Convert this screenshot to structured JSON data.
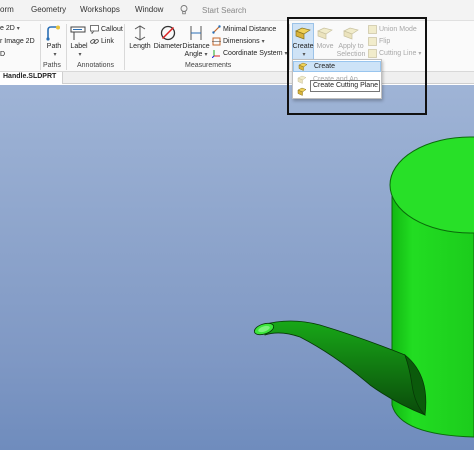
{
  "menubar": {
    "items": [
      "orm",
      "Geometry",
      "Workshops",
      "Window"
    ],
    "search_placeholder": "Start Search"
  },
  "ribbon": {
    "left_partial": [
      "e 2D",
      "r Image 2D",
      "D"
    ],
    "paths": {
      "button": "Path",
      "group": "Paths"
    },
    "annotations": {
      "label_button": "Label",
      "callout": "Callout",
      "link": "Link",
      "group": "Annotations"
    },
    "measurements": {
      "length": "Length",
      "diameter": "Diameter",
      "distance_angle_line1": "Distance",
      "distance_angle_line2": "Angle",
      "minimal_distance": "Minimal Distance",
      "dimensions": "Dimensions",
      "coordinate_system": "Coordinate System",
      "group": "Measurements"
    },
    "sections": {
      "create": "Create",
      "move": "Move",
      "apply_line1": "Apply to",
      "apply_line2": "Selection",
      "union_mode": "Union Mode",
      "flip": "Flip",
      "cutting_line": "Cutting Line"
    }
  },
  "document_tab": "Handle.SLDPRT",
  "dropdown": {
    "items": [
      "Create",
      "Create and Ap...",
      ""
    ],
    "tooltip": "Create Cutting Plane"
  },
  "colors": {
    "model_green": "#22dd22",
    "model_dark_green": "#0e5c0e",
    "highlight_border": "#111111"
  }
}
